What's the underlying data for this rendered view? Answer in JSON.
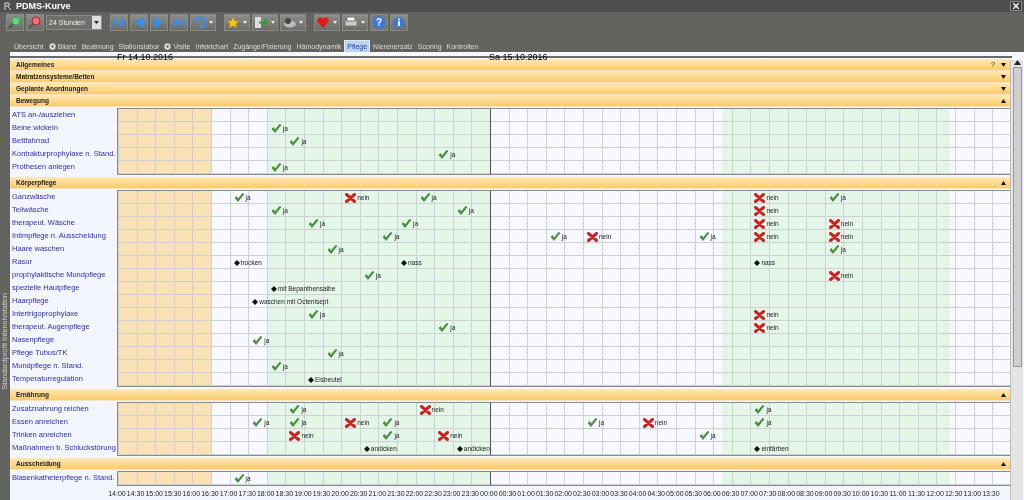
{
  "window": {
    "title": "PDMS-Kurve"
  },
  "toolbar": {
    "period": "24 Stunden",
    "help_glyph": "?"
  },
  "tabs": [
    {
      "label": "Übersicht",
      "icon": false,
      "selected": false
    },
    {
      "label": "Bilanz",
      "icon": true,
      "selected": false
    },
    {
      "label": "Beatmung",
      "icon": false,
      "selected": false
    },
    {
      "label": "Stationslabor",
      "icon": false,
      "selected": false
    },
    {
      "label": "Visite",
      "icon": true,
      "selected": false
    },
    {
      "label": "Infektchart",
      "icon": false,
      "selected": false
    },
    {
      "label": "Zugänge/Fixierung",
      "icon": false,
      "selected": false
    },
    {
      "label": "Hämodynamik",
      "icon": false,
      "selected": false
    },
    {
      "label": "Pflege",
      "icon": false,
      "selected": true
    },
    {
      "label": "Nierenersatz",
      "icon": false,
      "selected": false
    },
    {
      "label": "Scoring",
      "icon": false,
      "selected": false
    },
    {
      "label": "Kontrollen",
      "icon": false,
      "selected": false
    }
  ],
  "side_label": "Standardprofil Intensivstation",
  "dates": [
    "Fr 14.10.2016",
    "Sa 15.10.2016"
  ],
  "sections": [
    {
      "title": "Allgemeines",
      "help": "?",
      "expanded": false
    },
    {
      "title": "Matratzensysteme/Betten",
      "expanded": false
    },
    {
      "title": "Geplante Anordnungen",
      "expanded": false
    },
    {
      "title": "Bewegung",
      "expanded": true,
      "rows": [
        {
          "label": "ATS an-/ausziehen",
          "cells": []
        },
        {
          "label": "Beine wickeln",
          "cells": [
            null,
            null,
            null,
            null,
            null,
            null,
            null,
            null,
            {
              "kind": "check",
              "text": "ja"
            }
          ]
        },
        {
          "label": "Bettfahrrad",
          "cells": [
            null,
            null,
            null,
            null,
            null,
            null,
            null,
            null,
            null,
            {
              "kind": "check",
              "text": "ja"
            }
          ]
        },
        {
          "label": "Kontrakturprophylaxe n. Stand.",
          "cells": [
            null,
            null,
            null,
            null,
            null,
            null,
            null,
            null,
            null,
            null,
            null,
            null,
            null,
            null,
            null,
            null,
            null,
            {
              "kind": "check",
              "text": "ja"
            }
          ]
        },
        {
          "label": "Prothesen anlegen",
          "cells": [
            null,
            null,
            null,
            null,
            null,
            null,
            null,
            null,
            {
              "kind": "check",
              "text": "ja"
            }
          ]
        }
      ]
    },
    {
      "title": "Körperpflege",
      "expanded": true,
      "rows": [
        {
          "label": "Ganzwäsche",
          "cells": [
            null,
            null,
            null,
            null,
            null,
            null,
            {
              "kind": "check",
              "text": "ja"
            },
            null,
            null,
            null,
            null,
            null,
            {
              "kind": "cross",
              "text": "nein"
            },
            null,
            null,
            null,
            {
              "kind": "check",
              "text": "ja"
            },
            null,
            null,
            null,
            null,
            null,
            null,
            null,
            null,
            null,
            null,
            null,
            null,
            null,
            null,
            null,
            null,
            null,
            {
              "kind": "cross",
              "text": "nein"
            },
            null,
            null,
            null,
            {
              "kind": "check",
              "text": "ja"
            }
          ]
        },
        {
          "label": "Teilwäsche",
          "cells": [
            null,
            null,
            null,
            null,
            null,
            null,
            null,
            null,
            {
              "kind": "check",
              "text": "ja"
            },
            null,
            null,
            null,
            null,
            null,
            null,
            null,
            null,
            null,
            {
              "kind": "check",
              "text": "ja"
            },
            null,
            null,
            null,
            null,
            null,
            null,
            null,
            null,
            null,
            null,
            null,
            null,
            null,
            null,
            null,
            {
              "kind": "cross",
              "text": "nein"
            }
          ]
        },
        {
          "label": "therapeut. Wäsche",
          "cells": [
            null,
            null,
            null,
            null,
            null,
            null,
            null,
            null,
            null,
            null,
            {
              "kind": "check",
              "text": "ja"
            },
            null,
            null,
            null,
            null,
            {
              "kind": "check",
              "text": "ja"
            },
            null,
            null,
            null,
            null,
            null,
            null,
            null,
            null,
            null,
            null,
            null,
            null,
            null,
            null,
            null,
            null,
            null,
            null,
            {
              "kind": "cross",
              "text": "nein"
            },
            null,
            null,
            null,
            {
              "kind": "cross",
              "text": "nein"
            }
          ]
        },
        {
          "label": "Intimpflege n. Ausscheidung",
          "cells": [
            null,
            null,
            null,
            null,
            null,
            null,
            null,
            null,
            null,
            null,
            null,
            null,
            null,
            null,
            {
              "kind": "check",
              "text": "ja"
            },
            null,
            null,
            null,
            null,
            null,
            null,
            null,
            null,
            {
              "kind": "check",
              "text": "ja"
            },
            null,
            {
              "kind": "cross",
              "text": "nein"
            },
            null,
            null,
            null,
            null,
            null,
            {
              "kind": "check",
              "text": "ja"
            },
            null,
            null,
            {
              "kind": "cross",
              "text": "nein"
            },
            null,
            null,
            null,
            {
              "kind": "cross",
              "text": "nein"
            }
          ]
        },
        {
          "label": "Haare waschen",
          "cells": [
            null,
            null,
            null,
            null,
            null,
            null,
            null,
            null,
            null,
            null,
            null,
            {
              "kind": "check",
              "text": "ja"
            },
            null,
            null,
            null,
            null,
            null,
            null,
            null,
            null,
            null,
            null,
            null,
            null,
            null,
            null,
            null,
            null,
            null,
            null,
            null,
            null,
            null,
            null,
            null,
            null,
            null,
            null,
            {
              "kind": "check",
              "text": "ja"
            }
          ]
        },
        {
          "label": "Rasur",
          "cells": [
            null,
            null,
            null,
            null,
            null,
            null,
            {
              "kind": "note",
              "text": "trocken"
            },
            null,
            null,
            null,
            null,
            null,
            null,
            null,
            null,
            {
              "kind": "note",
              "text": "nass"
            },
            null,
            null,
            null,
            null,
            null,
            null,
            null,
            null,
            null,
            null,
            null,
            null,
            null,
            null,
            null,
            null,
            null,
            null,
            {
              "kind": "note",
              "text": "nass"
            }
          ]
        },
        {
          "label": "prophylaktische Mundpflege",
          "cells": [
            null,
            null,
            null,
            null,
            null,
            null,
            null,
            null,
            null,
            null,
            null,
            null,
            null,
            {
              "kind": "check",
              "text": "ja"
            },
            null,
            null,
            null,
            null,
            null,
            null,
            null,
            null,
            null,
            null,
            null,
            null,
            null,
            null,
            null,
            null,
            null,
            null,
            null,
            null,
            null,
            null,
            null,
            null,
            {
              "kind": "cross",
              "text": "nein"
            }
          ]
        },
        {
          "label": "spezielle Hautpflege",
          "cells": [
            null,
            null,
            null,
            null,
            null,
            null,
            null,
            null,
            {
              "kind": "note",
              "text": "mit Bepanthensalbe"
            }
          ]
        },
        {
          "label": "Haarpflege",
          "cells": [
            null,
            null,
            null,
            null,
            null,
            null,
            null,
            {
              "kind": "note",
              "text": "waschen mit Octenisept"
            }
          ]
        },
        {
          "label": "Intertrigoprophylaxe",
          "cells": [
            null,
            null,
            null,
            null,
            null,
            null,
            null,
            null,
            null,
            null,
            {
              "kind": "check",
              "text": "ja"
            },
            null,
            null,
            null,
            null,
            null,
            null,
            null,
            null,
            null,
            null,
            null,
            null,
            null,
            null,
            null,
            null,
            null,
            null,
            null,
            null,
            null,
            null,
            null,
            {
              "kind": "cross",
              "text": "nein"
            }
          ]
        },
        {
          "label": "therapeut. Augenpflege",
          "cells": [
            null,
            null,
            null,
            null,
            null,
            null,
            null,
            null,
            null,
            null,
            null,
            null,
            null,
            null,
            null,
            null,
            null,
            {
              "kind": "check",
              "text": "ja"
            },
            null,
            null,
            null,
            null,
            null,
            null,
            null,
            null,
            null,
            null,
            null,
            null,
            null,
            null,
            null,
            null,
            {
              "kind": "cross",
              "text": "nein"
            }
          ]
        },
        {
          "label": "Nasenpflege",
          "cells": [
            null,
            null,
            null,
            null,
            null,
            null,
            null,
            {
              "kind": "check",
              "text": "ja"
            }
          ]
        },
        {
          "label": "Pflege Tubus/TK",
          "cells": [
            null,
            null,
            null,
            null,
            null,
            null,
            null,
            null,
            null,
            null,
            null,
            {
              "kind": "check",
              "text": "ja"
            }
          ]
        },
        {
          "label": "Mundpflege n. Stand.",
          "cells": [
            null,
            null,
            null,
            null,
            null,
            null,
            null,
            null,
            {
              "kind": "check",
              "text": "ja"
            }
          ]
        },
        {
          "label": "Temperaturregulation",
          "cells": [
            null,
            null,
            null,
            null,
            null,
            null,
            null,
            null,
            null,
            null,
            {
              "kind": "note",
              "text": "Eisbeutel"
            }
          ]
        }
      ]
    },
    {
      "title": "Ernährung",
      "expanded": true,
      "rows": [
        {
          "label": "Zusatznahrung reichen",
          "cells": [
            null,
            null,
            null,
            null,
            null,
            null,
            null,
            null,
            null,
            {
              "kind": "check",
              "text": "ja"
            },
            null,
            null,
            null,
            null,
            null,
            null,
            {
              "kind": "cross",
              "text": "nein"
            },
            null,
            null,
            null,
            null,
            null,
            null,
            null,
            null,
            null,
            null,
            null,
            null,
            null,
            null,
            null,
            null,
            null,
            {
              "kind": "check",
              "text": "ja"
            }
          ]
        },
        {
          "label": "Essen anreichen",
          "cells": [
            null,
            null,
            null,
            null,
            null,
            null,
            null,
            {
              "kind": "check",
              "text": "ja"
            },
            null,
            {
              "kind": "check",
              "text": "ja"
            },
            null,
            null,
            {
              "kind": "cross",
              "text": "nein"
            },
            null,
            {
              "kind": "check",
              "text": "ja"
            },
            null,
            null,
            null,
            null,
            null,
            null,
            null,
            null,
            null,
            null,
            {
              "kind": "check",
              "text": "ja"
            },
            null,
            null,
            {
              "kind": "cross",
              "text": "nein"
            },
            null,
            null,
            null,
            null,
            null,
            {
              "kind": "check",
              "text": "ja"
            }
          ]
        },
        {
          "label": "Trinken anreichen",
          "cells": [
            null,
            null,
            null,
            null,
            null,
            null,
            null,
            null,
            null,
            {
              "kind": "cross",
              "text": "nein"
            },
            null,
            null,
            null,
            null,
            {
              "kind": "check",
              "text": "ja"
            },
            null,
            null,
            {
              "kind": "cross",
              "text": "nein"
            },
            null,
            null,
            null,
            null,
            null,
            null,
            null,
            null,
            null,
            null,
            null,
            null,
            null,
            {
              "kind": "check",
              "text": "ja"
            }
          ]
        },
        {
          "label": "Maßnahmen b. Schluckstörung",
          "cells": [
            null,
            null,
            null,
            null,
            null,
            null,
            null,
            null,
            null,
            null,
            null,
            null,
            null,
            {
              "kind": "note",
              "text": "andicken"
            },
            null,
            null,
            null,
            null,
            {
              "kind": "note",
              "text": "andicken"
            },
            null,
            null,
            null,
            null,
            null,
            null,
            null,
            null,
            null,
            null,
            null,
            null,
            null,
            null,
            null,
            {
              "kind": "note",
              "text": "einfärben"
            }
          ]
        }
      ]
    },
    {
      "title": "Ausscheidung",
      "expanded": true,
      "rows": [
        {
          "label": "Blasenkatheterpflege n. Stand.",
          "cells": [
            null,
            null,
            null,
            null,
            null,
            null,
            {
              "kind": "check",
              "text": "ja"
            }
          ]
        }
      ]
    }
  ],
  "time_axis": [
    "14:00",
    "14:30",
    "15:00",
    "15:30",
    "16:00",
    "16:30",
    "17:00",
    "17:30",
    "18:00",
    "18:30",
    "19:00",
    "19:30",
    "20:00",
    "20:30",
    "21:00",
    "21:30",
    "22:00",
    "22:30",
    "23:00",
    "23:30",
    "00:00",
    "00:30",
    "01:00",
    "01:30",
    "02:00",
    "02:30",
    "03:00",
    "03:30",
    "04:00",
    "04:30",
    "05:00",
    "05:30",
    "06:00",
    "06:30",
    "07:00",
    "07:30",
    "08:00",
    "08:30",
    "09:00",
    "09:30",
    "10:00",
    "10:30",
    "11:00",
    "11:30",
    "12:00",
    "12:30",
    "13:00",
    "13:30"
  ]
}
